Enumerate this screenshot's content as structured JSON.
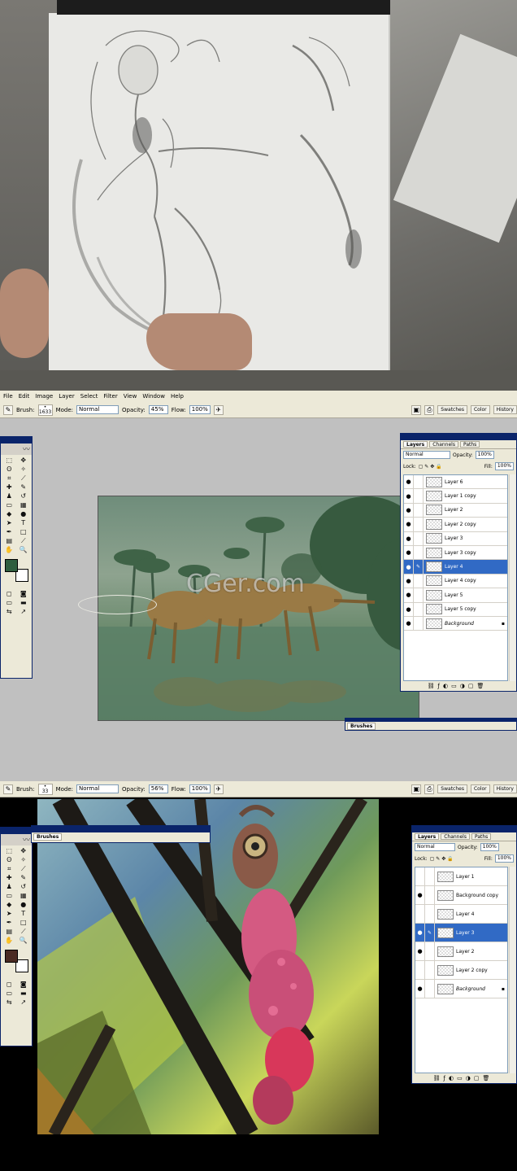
{
  "panel1": {
    "description_visible": false
  },
  "ps1": {
    "menu": [
      "File",
      "Edit",
      "Image",
      "Layer",
      "Select",
      "Filter",
      "View",
      "Window",
      "Help"
    ],
    "options": {
      "brush_label": "Brush:",
      "brush_size": "1633",
      "mode_label": "Mode:",
      "mode_value": "Normal",
      "opacity_label": "Opacity:",
      "opacity_value": "45%",
      "flow_label": "Flow:",
      "flow_value": "100%"
    },
    "well_tabs": [
      "Swatches",
      "Color",
      "History"
    ],
    "watermark": "CGer.com",
    "fg_color": "#2f5e3e",
    "layers": {
      "tabs": [
        "Layers",
        "Channels",
        "Paths"
      ],
      "blend": "Normal",
      "opacity_label": "Opacity:",
      "opacity_value": "100%",
      "lock_label": "Lock:",
      "fill_label": "Fill:",
      "fill_value": "100%",
      "rows": [
        {
          "name": "Layer 6",
          "visible": true,
          "active": false
        },
        {
          "name": "Layer 1 copy",
          "visible": true,
          "active": false
        },
        {
          "name": "Layer 2",
          "visible": true,
          "active": false
        },
        {
          "name": "Layer 2 copy",
          "visible": true,
          "active": false
        },
        {
          "name": "Layer 3",
          "visible": true,
          "active": false
        },
        {
          "name": "Layer 3 copy",
          "visible": true,
          "active": false
        },
        {
          "name": "Layer 4",
          "visible": true,
          "active": true
        },
        {
          "name": "Layer 4 copy",
          "visible": true,
          "active": false
        },
        {
          "name": "Layer 5",
          "visible": true,
          "active": false
        },
        {
          "name": "Layer 5 copy",
          "visible": true,
          "active": false
        },
        {
          "name": "Background",
          "visible": true,
          "active": false
        }
      ]
    },
    "brushes_label": "Brushes"
  },
  "ps2": {
    "options": {
      "brush_label": "Brush:",
      "brush_size": "33",
      "mode_label": "Mode:",
      "mode_value": "Normal",
      "opacity_label": "Opacity:",
      "opacity_value": "56%",
      "flow_label": "Flow:",
      "flow_value": "100%"
    },
    "well_tabs": [
      "Swatches",
      "Color",
      "History"
    ],
    "fg_color": "#4a2a22",
    "brushes_label": "Brushes",
    "layers": {
      "tabs": [
        "Layers",
        "Channels",
        "Paths"
      ],
      "blend": "Normal",
      "opacity_label": "Opacity:",
      "opacity_value": "100%",
      "lock_label": "Lock:",
      "fill_label": "Fill:",
      "fill_value": "100%",
      "rows": [
        {
          "name": "Layer 1",
          "visible": false,
          "active": false
        },
        {
          "name": "Background copy",
          "visible": true,
          "active": false
        },
        {
          "name": "Layer 4",
          "visible": false,
          "active": false
        },
        {
          "name": "Layer 3",
          "visible": true,
          "active": true
        },
        {
          "name": "Layer 2",
          "visible": true,
          "active": false
        },
        {
          "name": "Layer 2 copy",
          "visible": false,
          "active": false
        },
        {
          "name": "Background",
          "visible": true,
          "active": false
        }
      ]
    }
  },
  "icons": {
    "eye": "👁",
    "brush": "brush-icon",
    "lock": "lock-icon"
  }
}
